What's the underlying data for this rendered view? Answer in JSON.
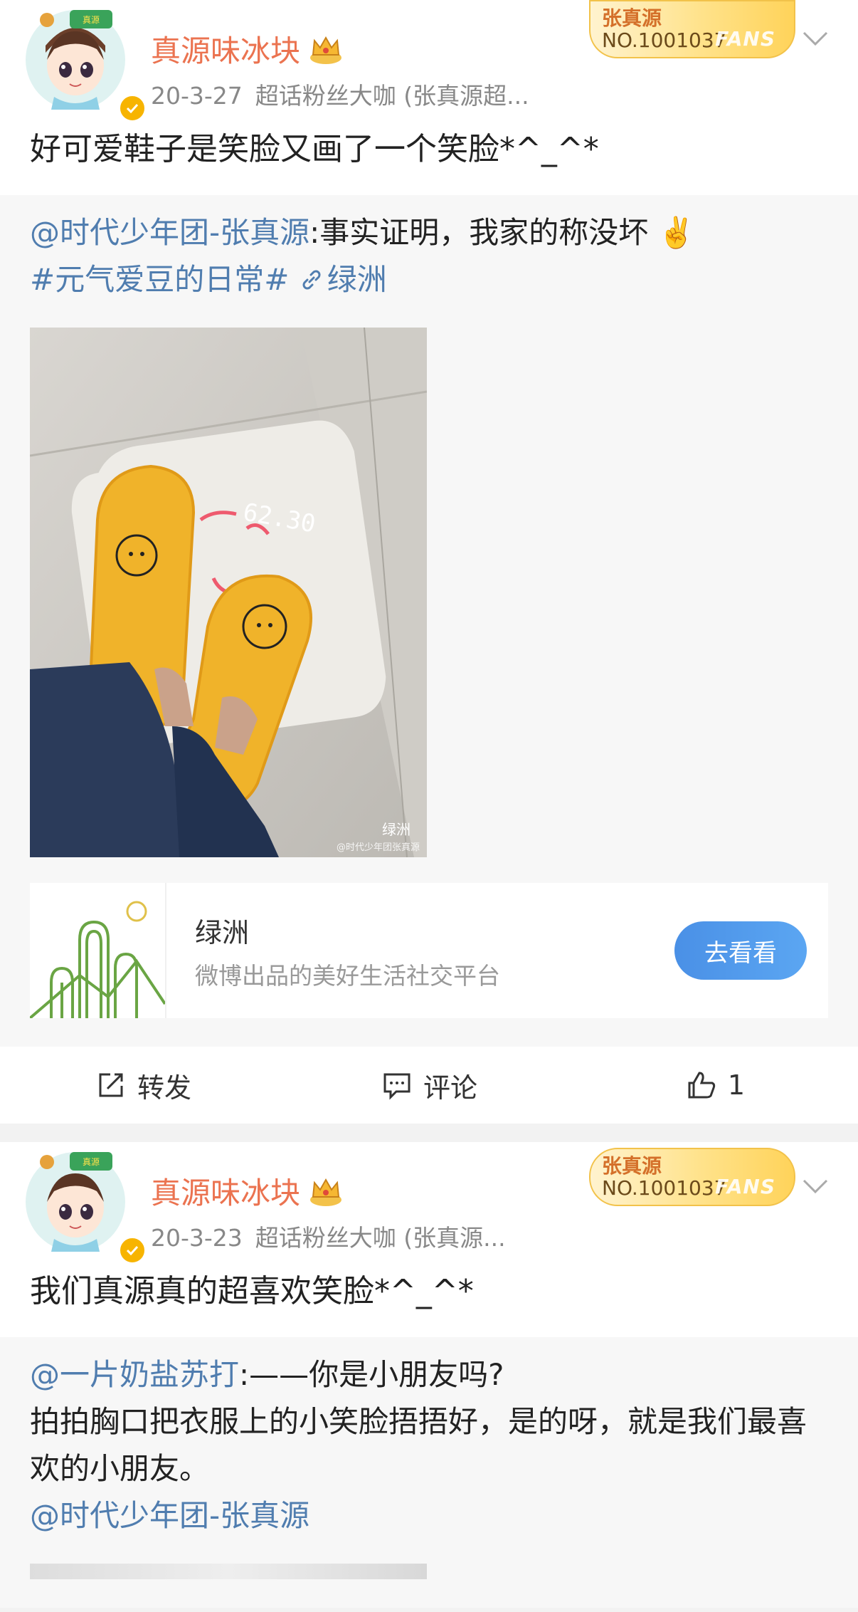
{
  "posts": [
    {
      "username": "真源味冰块",
      "date": "20-3-27",
      "source": "超话粉丝大咖 (张真源超...",
      "fans_badge": {
        "name": "张真源",
        "number": "NO.1001037",
        "label": "FANS"
      },
      "text": "好可爱鞋子是笑脸又画了一个笑脸*^_^*",
      "repost": {
        "mention": "@时代少年团-张真源",
        "text": ":事实证明，我家的称没坏",
        "emoji": "✌️",
        "hashtag": "#元气爱豆的日常#",
        "location_link": "绿洲",
        "photo": {
          "scale_reading": "62.30",
          "watermark": "绿洲",
          "watermark_sub": "@时代少年团张真源"
        },
        "card": {
          "title": "绿洲",
          "description": "微博出品的美好生活社交平台",
          "button": "去看看"
        }
      },
      "actions": {
        "repost": "转发",
        "comment": "评论",
        "likes": "1"
      }
    },
    {
      "username": "真源味冰块",
      "date": "20-3-23",
      "source": "超话粉丝大咖 (张真源...",
      "fans_badge": {
        "name": "张真源",
        "number": "NO.1001037",
        "label": "FANS"
      },
      "text": "我们真源真的超喜欢笑脸*^_^*",
      "repost": {
        "mention": "@一片奶盐苏打",
        "line1": ":——你是小朋友吗?",
        "line2": "拍拍胸口把衣服上的小笑脸捂捂好，是的呀，就是我们最喜欢的小朋友。",
        "mention2": "@时代少年团-张真源"
      }
    }
  ]
}
